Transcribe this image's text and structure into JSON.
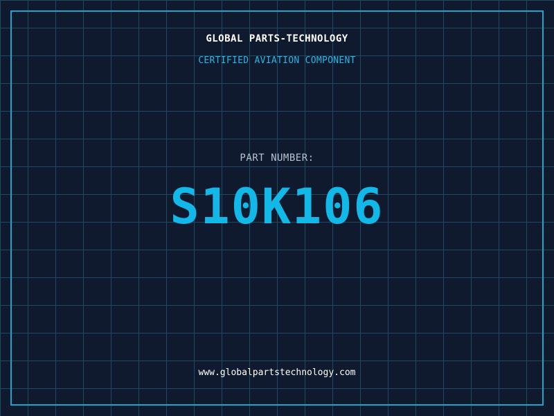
{
  "header": {
    "company": "GLOBAL PARTS-TECHNOLOGY",
    "subtitle": "CERTIFIED AVIATION COMPONENT"
  },
  "part": {
    "label": "PART NUMBER:",
    "number": "S10K106"
  },
  "footer": {
    "website": "www.globalpartstechnology.com"
  },
  "colors": {
    "background": "#0f1a2e",
    "grid": "#1e4a63",
    "accent": "#12b8e8",
    "frame": "#1fa3cf"
  }
}
